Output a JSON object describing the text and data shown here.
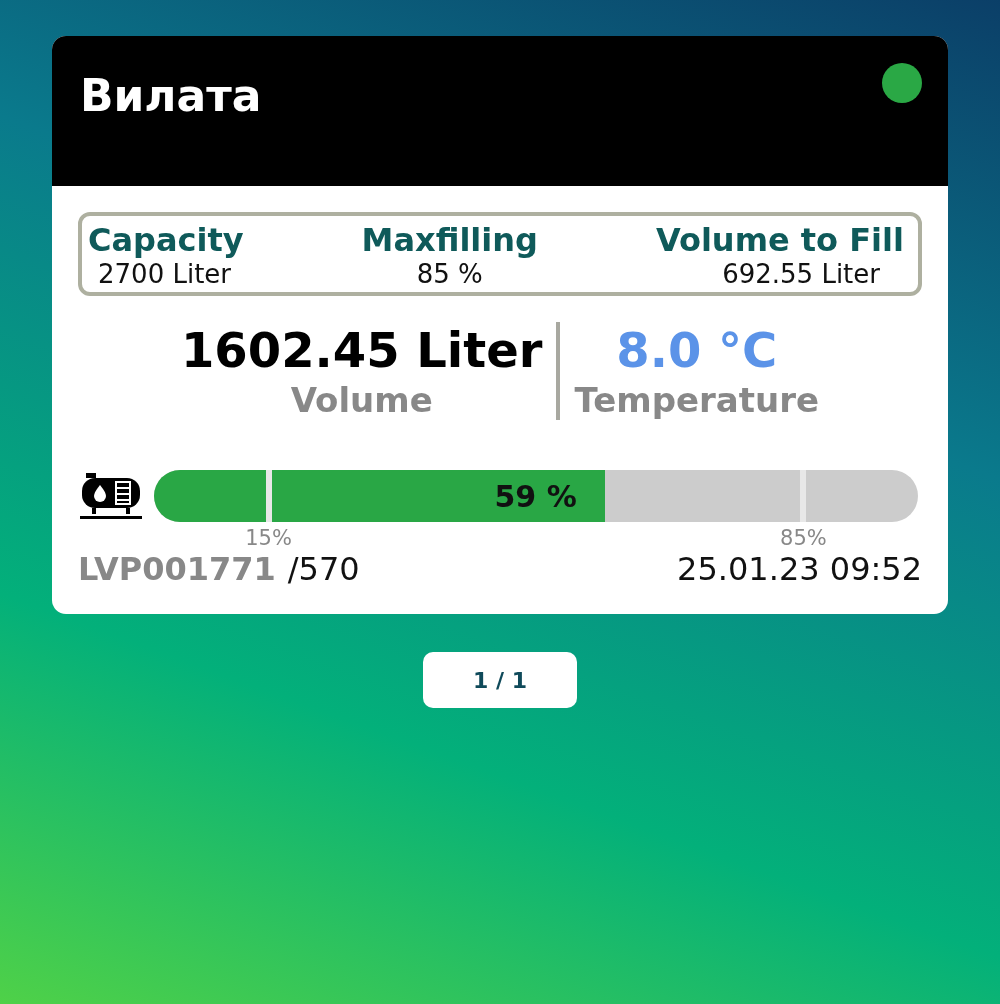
{
  "card": {
    "title": "Вилата",
    "status": {
      "color": "#2aa845"
    }
  },
  "stats": [
    {
      "label": "Capacity",
      "value": "2700 Liter"
    },
    {
      "label": "Maxfilling",
      "value": "85 %"
    },
    {
      "label": "Volume to Fill",
      "value": "692.55 Liter"
    }
  ],
  "readings": [
    {
      "value": "1602.45 Liter",
      "label": "Volume",
      "kind": "volume"
    },
    {
      "value": "8.0 °C",
      "label": "Temperature",
      "kind": "temperature"
    }
  ],
  "gauge": {
    "level": 0.59,
    "reading": "59 %",
    "markers": [
      {
        "label": "15%",
        "level": 0.15
      },
      {
        "label": "85%",
        "level": 0.85
      }
    ]
  },
  "footer": {
    "device_id": "LVP001771",
    "suffix": "/570",
    "timestamp": "25.01.23 09:52"
  },
  "pager": {
    "label": "1 / 1"
  }
}
